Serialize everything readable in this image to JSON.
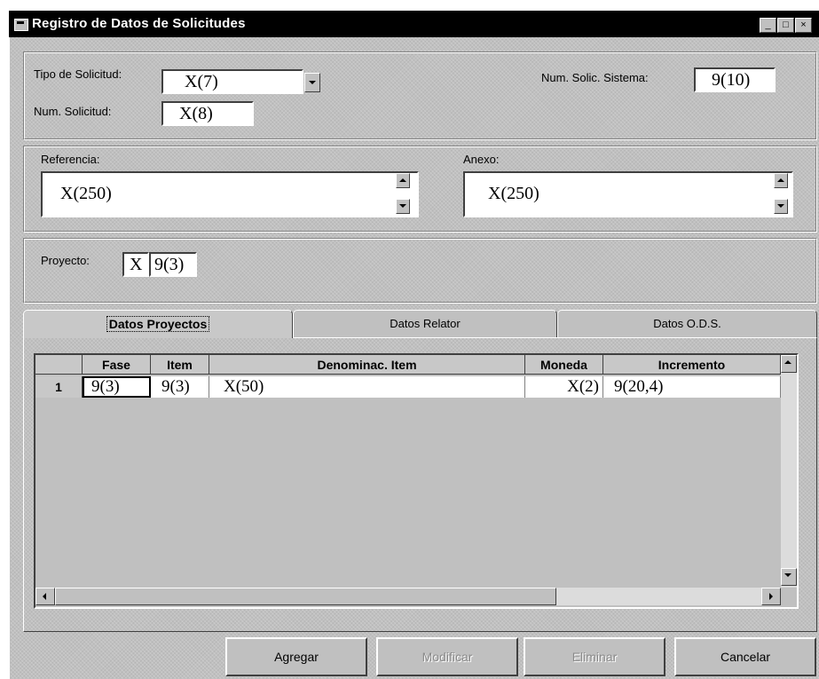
{
  "window": {
    "title": "Registro de Datos de Solicitudes"
  },
  "header": {
    "tipo_label": "Tipo de Solicitud:",
    "tipo_value": "X(7)",
    "num_solicitud_label": "Num. Solicitud:",
    "num_solicitud_value": "X(8)",
    "num_sistema_label": "Num. Solic. Sistema:",
    "num_sistema_value": "9(10)"
  },
  "references": {
    "referencia_label": "Referencia:",
    "referencia_value": "X(250)",
    "anexo_label": "Anexo:",
    "anexo_value": "X(250)"
  },
  "project": {
    "label": "Proyecto:",
    "value_a": "X",
    "value_b": "9(3)"
  },
  "tabs": [
    {
      "label": "Datos Proyectos"
    },
    {
      "label": "Datos Relator"
    },
    {
      "label": "Datos O.D.S."
    }
  ],
  "grid": {
    "headers": [
      "Fase",
      "Item",
      "Denominac. Item",
      "Moneda",
      "Incremento"
    ],
    "rows": [
      {
        "num": "1",
        "fase": "9(3)",
        "item": "9(3)",
        "denominac": "X(50)",
        "moneda": "X(2)",
        "incremento": "9(20,4)"
      }
    ]
  },
  "buttons": {
    "agregar": "Agregar",
    "modificar": "Modificar",
    "eliminar": "Eliminar",
    "cancelar": "Cancelar"
  }
}
